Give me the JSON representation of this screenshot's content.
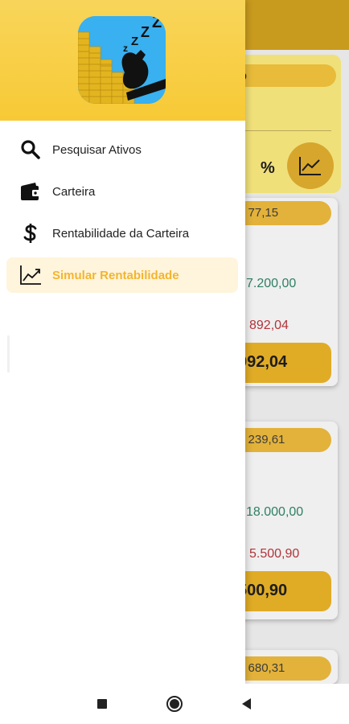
{
  "drawer": {
    "menu": [
      {
        "label": "Pesquisar Ativos",
        "icon": "search-icon",
        "active": false
      },
      {
        "label": "Carteira",
        "icon": "wallet-icon",
        "active": false
      },
      {
        "label": "Rentabilidade da Carteira",
        "icon": "dollar-icon",
        "active": false
      },
      {
        "label": "Simular Rentabilidade",
        "icon": "trending-up-icon",
        "active": true
      }
    ]
  },
  "background": {
    "header_title": "o",
    "percent_label": "%",
    "cards": [
      {
        "pill": "$ 77,15",
        "green": "7.200,00",
        "red": "892,04",
        "total": "092,04"
      },
      {
        "pill": "$ 239,61",
        "green": "18.000,00",
        "red": "5.500,90",
        "total": "500,90"
      },
      {
        "pill": "$ 680,31"
      }
    ]
  },
  "colors": {
    "accent": "#f3b52e",
    "active_bg": "#fff4dc",
    "header_yellow": "#f7c935",
    "positive": "#2f7f64",
    "negative": "#b2343a"
  }
}
